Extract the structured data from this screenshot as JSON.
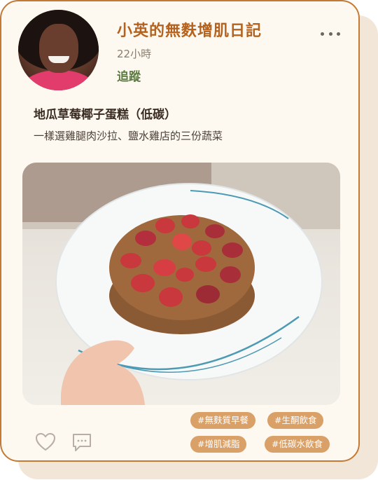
{
  "post": {
    "author_name": "小英的無麩增肌日記",
    "time_ago": "22小時",
    "follow_label": "追蹤",
    "title": "地瓜草莓椰子蛋糕（低碳）",
    "description": "一樣選雞腿肉沙拉、鹽水雞店的三份蔬菜"
  },
  "tags": [
    "#無麩質早餐",
    "#生酮飲食",
    "#增肌減脂",
    "#低碳水飲食"
  ],
  "icons": {
    "like": "heart-icon",
    "comment": "comment-icon",
    "menu": "more-options-icon"
  },
  "colors": {
    "accent": "#b4621d",
    "follow": "#5c7a41",
    "tag_bg": "#d9a068",
    "card_border": "#c47a35"
  }
}
